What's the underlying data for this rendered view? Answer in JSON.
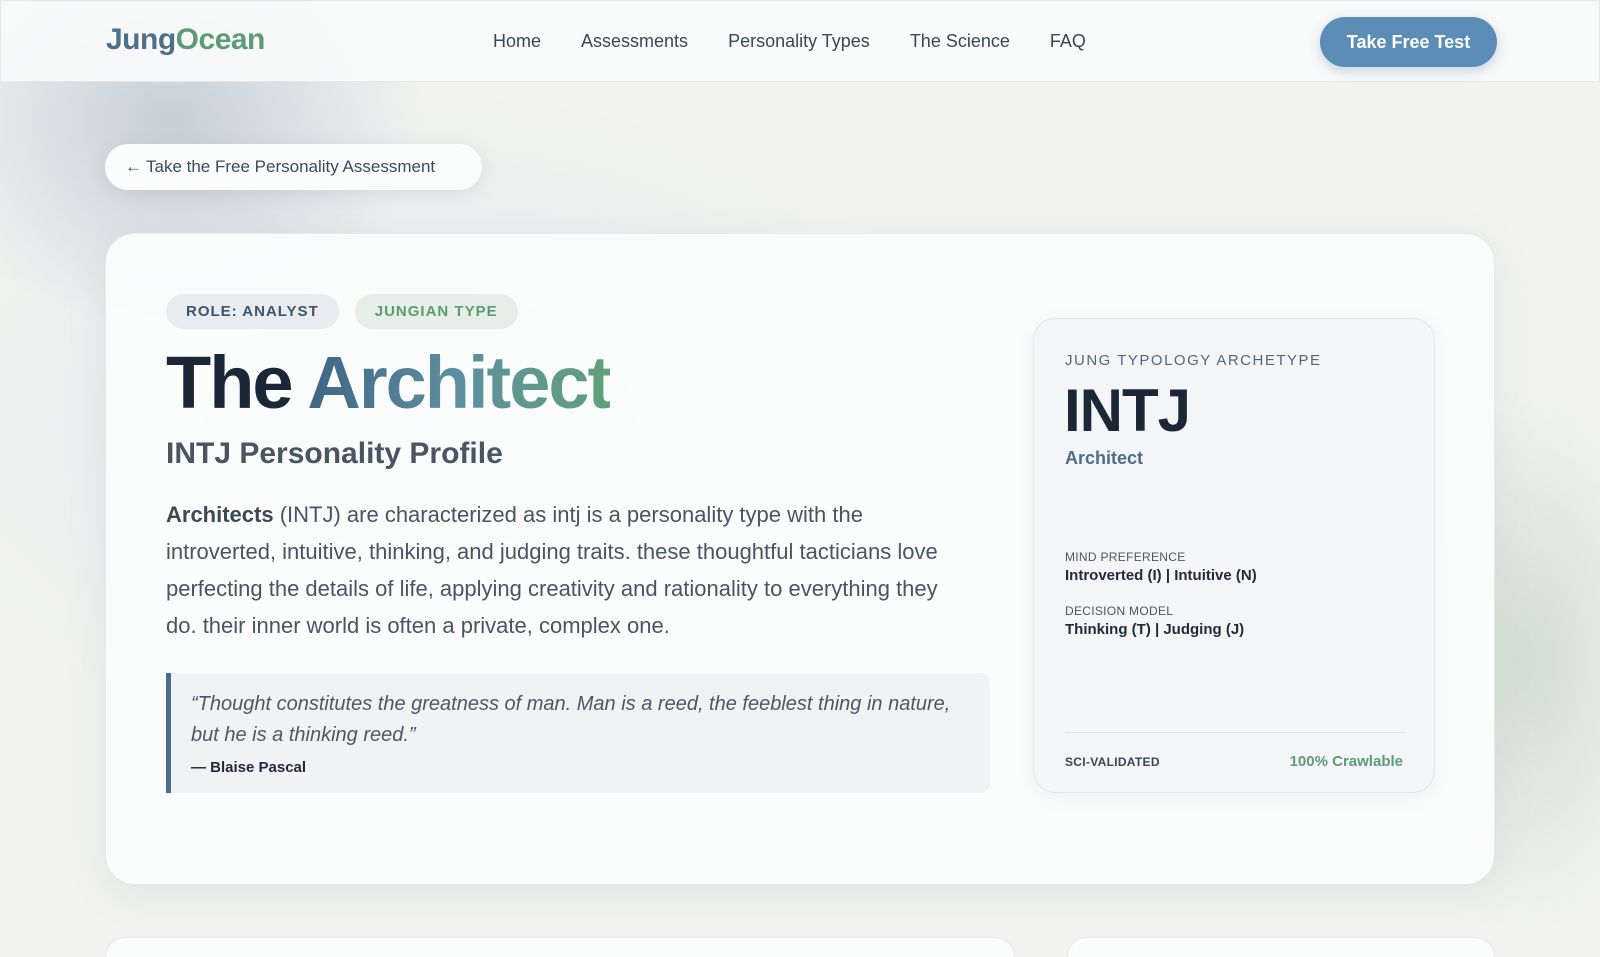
{
  "header": {
    "logo_part1": "Jung",
    "logo_part2": "Ocean",
    "nav": [
      "Home",
      "Assessments",
      "Personality Types",
      "The Science",
      "FAQ"
    ],
    "cta_label": "Take Free Test"
  },
  "back_link": {
    "arrow": "←",
    "label": "Take the Free Personality Assessment"
  },
  "profile": {
    "badge_role": "ROLE: ANALYST",
    "badge_type": "JUNGIAN TYPE",
    "title_part1": "The",
    "title_part2": "Architect",
    "subtitle": "INTJ Personality Profile",
    "desc_bold": "Architects",
    "desc_rest": " (INTJ) are characterized as intj is a personality type with the introverted, intuitive, thinking, and judging traits. these thoughtful tacticians love perfecting the details of life, applying creativity and rationality to everything they do. their inner world is often a private, complex one.",
    "quote_text": "“Thought constitutes the greatness of man. Man is a reed, the feeblest thing in nature, but he is a thinking reed.”",
    "quote_author": "— Blaise Pascal"
  },
  "side_card": {
    "eyebrow": "JUNG TYPOLOGY ARCHETYPE",
    "code": "INTJ",
    "name": "Architect",
    "mind_label": "MIND PREFERENCE",
    "mind_value": "Introverted (I) | Intuitive (N)",
    "decision_label": "DECISION MODEL",
    "decision_value": "Thinking (T) | Judging (J)",
    "foot_left": "SCI-VALIDATED",
    "foot_right": "100% Crawlable"
  },
  "colors": {
    "accent_blue": "#5b8db7",
    "accent_green": "#5f9a78",
    "heading_dark": "#1b2636"
  }
}
